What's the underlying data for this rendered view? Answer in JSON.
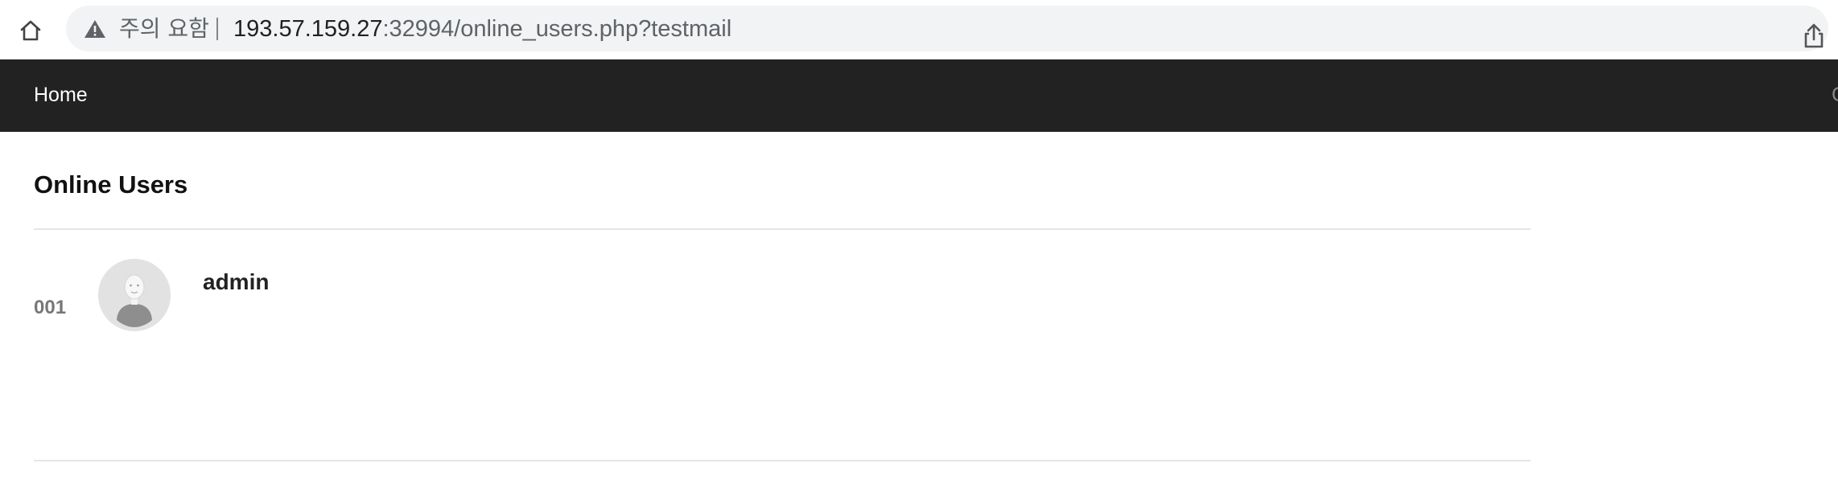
{
  "browser": {
    "security_label": "주의 요함",
    "url_host": "193.57.159.27",
    "url_rest": ":32994/online_users.php?testmail"
  },
  "navbar": {
    "home_label": "Home",
    "edge_label": "C"
  },
  "page": {
    "title": "Online Users"
  },
  "users": [
    {
      "number": "001",
      "name": "admin"
    }
  ]
}
